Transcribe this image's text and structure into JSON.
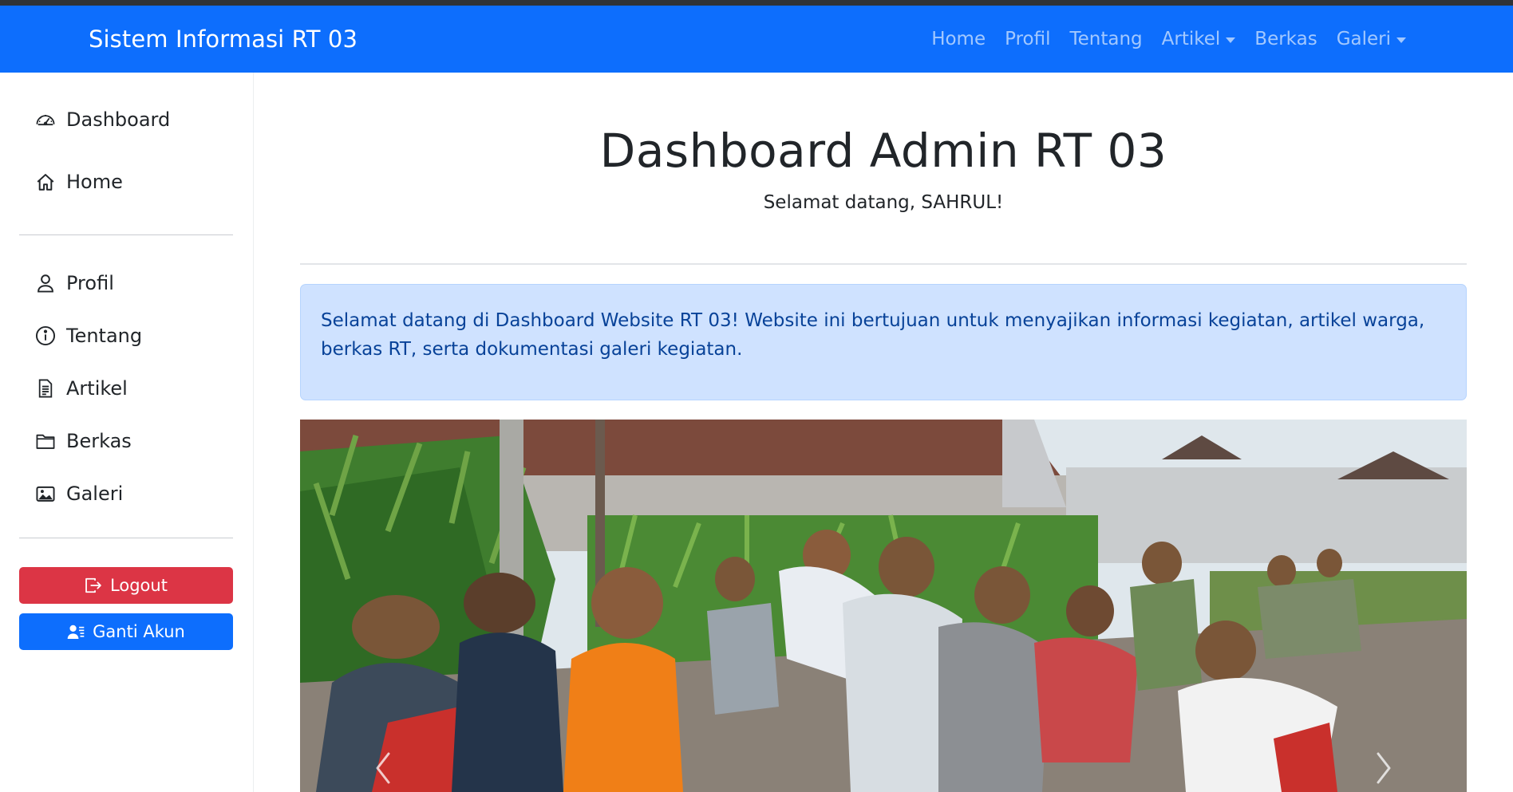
{
  "navbar": {
    "brand": "Sistem Informasi RT 03",
    "links": [
      {
        "label": "Home"
      },
      {
        "label": "Profil"
      },
      {
        "label": "Tentang"
      },
      {
        "label": "Artikel",
        "dropdown": true
      },
      {
        "label": "Berkas"
      },
      {
        "label": "Galeri",
        "dropdown": true
      }
    ],
    "bg_color": "#0d6efd"
  },
  "sidebar": {
    "items": [
      {
        "label": "Dashboard",
        "icon": "speedometer-icon"
      },
      {
        "label": "Home",
        "icon": "house-icon"
      },
      {
        "label": "Profil",
        "icon": "person-icon"
      },
      {
        "label": "Tentang",
        "icon": "info-circle-icon"
      },
      {
        "label": "Artikel",
        "icon": "file-text-icon"
      },
      {
        "label": "Berkas",
        "icon": "folder-icon"
      },
      {
        "label": "Galeri",
        "icon": "images-icon"
      }
    ],
    "logout_label": "Logout",
    "switch_account_label": "Ganti Akun"
  },
  "main": {
    "title": "Dashboard Admin RT 03",
    "welcome": "Selamat datang, SAHRUL!",
    "alert_text": "Selamat datang di Dashboard Website RT 03! Website ini bertujuan untuk menyajikan informasi kegiatan, artikel warga, berkas RT, serta dokumentasi galeri kegiatan.",
    "carousel": {
      "image_subject": "community work photo (people working in a field)",
      "prev_icon": "chevron-left-icon",
      "next_icon": "chevron-right-icon"
    }
  },
  "colors": {
    "primary": "#0d6efd",
    "danger": "#dc3545",
    "alert_bg": "#cfe2ff",
    "alert_text": "#084298"
  }
}
